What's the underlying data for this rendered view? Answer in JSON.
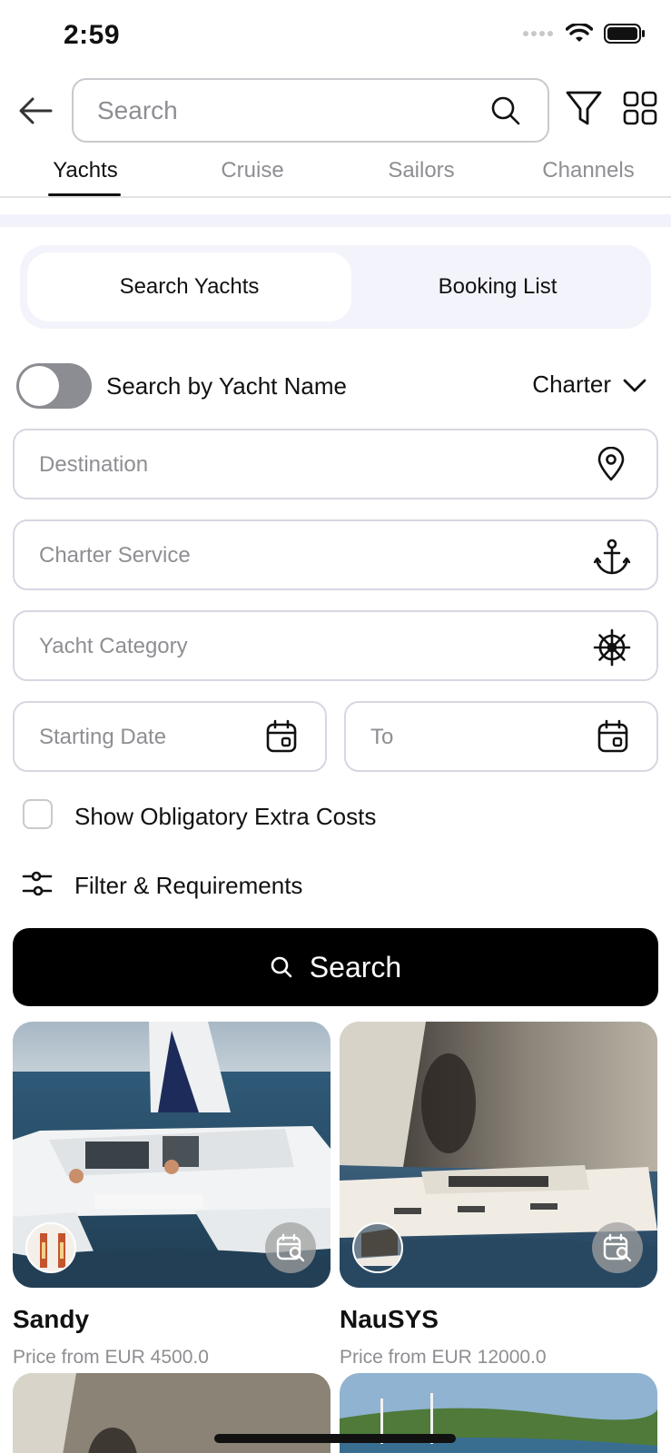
{
  "status_bar": {
    "time": "2:59"
  },
  "header": {
    "search_placeholder": "Search"
  },
  "tabs": [
    {
      "label": "Yachts",
      "active": true
    },
    {
      "label": "Cruise",
      "active": false
    },
    {
      "label": "Sailors",
      "active": false
    },
    {
      "label": "Channels",
      "active": false
    }
  ],
  "segment": {
    "search_yachts": "Search Yachts",
    "booking_list": "Booking List",
    "selected": "Search Yachts"
  },
  "search_by_name": {
    "label": "Search by Yacht Name",
    "enabled": false
  },
  "charter_dropdown": {
    "value": "Charter"
  },
  "fields": {
    "destination": "Destination",
    "charter_service": "Charter Service",
    "yacht_category": "Yacht Category",
    "starting_date": "Starting Date",
    "to": "To"
  },
  "extra_costs": {
    "label": "Show Obligatory Extra Costs",
    "checked": false
  },
  "filters": {
    "label": "Filter & Requirements"
  },
  "search_button": {
    "label": "Search"
  },
  "yachts": [
    {
      "name": "Sandy",
      "price": "Price from EUR 4500.0"
    },
    {
      "name": "NauSYS",
      "price": "Price from EUR 12000.0"
    }
  ],
  "icons": {
    "back": "arrow-left-icon",
    "search": "search-icon",
    "filter": "funnel-icon",
    "grid": "grid-icon",
    "destination": "map-pin-icon",
    "service": "anchor-icon",
    "category": "ship-wheel-icon",
    "calendar": "calendar-icon",
    "sliders": "sliders-icon",
    "availability": "calendar-search-icon"
  },
  "colors": {
    "accent": "#000000",
    "toggle_off": "#8c8d92",
    "placeholder": "#8e8e93",
    "segment_bg": "#f3f4fb"
  }
}
